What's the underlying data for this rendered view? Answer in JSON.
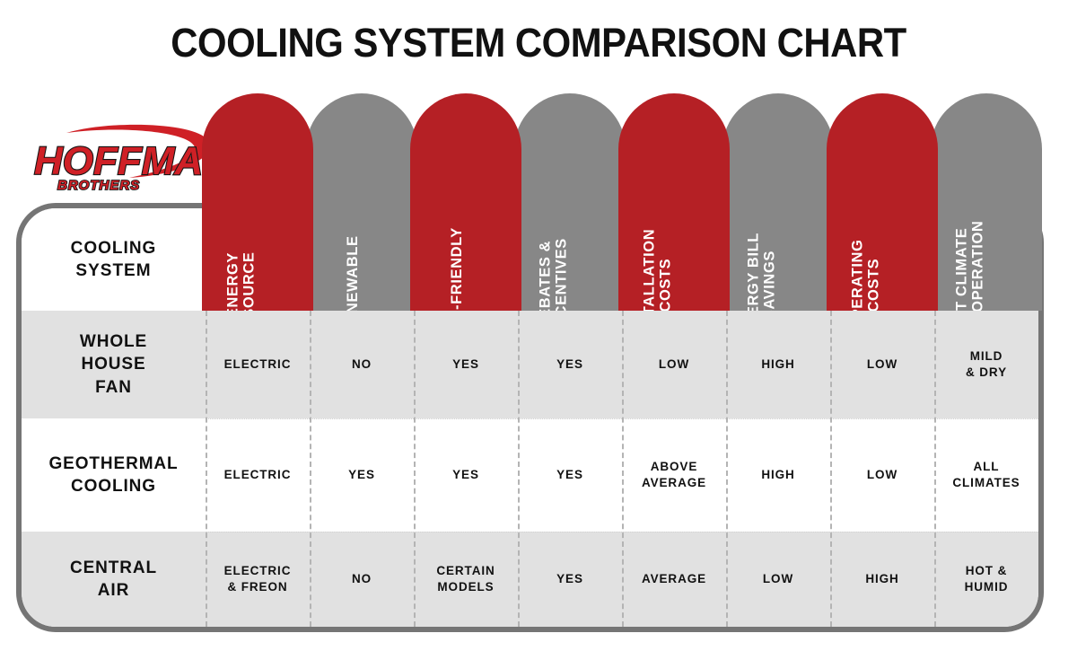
{
  "title": "COOLING SYSTEM COMPARISON CHART",
  "brand": {
    "logo_name": "hoffmann-brothers-logo",
    "word": "HOFFMANN",
    "sub": "BROTHERS",
    "red": "#cf2026",
    "outline": "#161616"
  },
  "colors": {
    "red_pill": "#b52025",
    "gray_pill": "#878787",
    "row_shaded": "#e1e1e1",
    "row_plain": "#ffffff",
    "card_border": "#757575",
    "divider": "#b4b4b4",
    "text": "#111111",
    "pill_text": "#ffffff"
  },
  "table": {
    "row_header_label": "COOLING SYSTEM",
    "row_header_lines": [
      "COOLING",
      "SYSTEM"
    ],
    "columns": [
      {
        "label": "ENERGY SOURCE",
        "lines": [
          "ENERGY",
          "SOURCE"
        ],
        "color": "red"
      },
      {
        "label": "RENEWABLE",
        "lines": [
          "RENEWABLE"
        ],
        "color": "gray"
      },
      {
        "label": "ECO-FRIENDLY",
        "lines": [
          "ECO-FRIENDLY"
        ],
        "color": "red"
      },
      {
        "label": "REBATES & INCENTIVES",
        "lines": [
          "REBATES &",
          "INCENTIVES"
        ],
        "color": "gray"
      },
      {
        "label": "INSTALLATION COSTS",
        "lines": [
          "INSTALLATION",
          "COSTS"
        ],
        "color": "red"
      },
      {
        "label": "ENERGY BILL SAVINGS",
        "lines": [
          "ENERGY BILL",
          "SAVINGS"
        ],
        "color": "gray"
      },
      {
        "label": "OPERATING COSTS",
        "lines": [
          "OPERATING",
          "COSTS"
        ],
        "color": "red"
      },
      {
        "label": "BEST CLIMATE FOR OPERATION",
        "lines": [
          "BEST CLIMATE",
          "FOR OPERATION"
        ],
        "color": "gray"
      }
    ],
    "rows": [
      {
        "system": "WHOLE HOUSE FAN",
        "system_lines": [
          "WHOLE",
          "HOUSE",
          "FAN"
        ],
        "band": "shaded",
        "cells": [
          {
            "value": "ELECTRIC",
            "lines": [
              "ELECTRIC"
            ]
          },
          {
            "value": "NO",
            "lines": [
              "NO"
            ]
          },
          {
            "value": "YES",
            "lines": [
              "YES"
            ]
          },
          {
            "value": "YES",
            "lines": [
              "YES"
            ]
          },
          {
            "value": "LOW",
            "lines": [
              "LOW"
            ]
          },
          {
            "value": "HIGH",
            "lines": [
              "HIGH"
            ]
          },
          {
            "value": "LOW",
            "lines": [
              "LOW"
            ]
          },
          {
            "value": "MILD & DRY",
            "lines": [
              "MILD",
              "& DRY"
            ]
          }
        ]
      },
      {
        "system": "GEOTHERMAL COOLING",
        "system_lines": [
          "GEOTHERMAL",
          "COOLING"
        ],
        "band": "plain",
        "cells": [
          {
            "value": "ELECTRIC",
            "lines": [
              "ELECTRIC"
            ]
          },
          {
            "value": "YES",
            "lines": [
              "YES"
            ]
          },
          {
            "value": "YES",
            "lines": [
              "YES"
            ]
          },
          {
            "value": "YES",
            "lines": [
              "YES"
            ]
          },
          {
            "value": "ABOVE AVERAGE",
            "lines": [
              "ABOVE",
              "AVERAGE"
            ]
          },
          {
            "value": "HIGH",
            "lines": [
              "HIGH"
            ]
          },
          {
            "value": "LOW",
            "lines": [
              "LOW"
            ]
          },
          {
            "value": "ALL CLIMATES",
            "lines": [
              "ALL",
              "CLIMATES"
            ]
          }
        ]
      },
      {
        "system": "CENTRAL AIR",
        "system_lines": [
          "CENTRAL",
          "AIR"
        ],
        "band": "shaded",
        "cells": [
          {
            "value": "ELECTRIC & FREON",
            "lines": [
              "ELECTRIC",
              "& FREON"
            ]
          },
          {
            "value": "NO",
            "lines": [
              "NO"
            ]
          },
          {
            "value": "CERTAIN MODELS",
            "lines": [
              "CERTAIN",
              "MODELS"
            ]
          },
          {
            "value": "YES",
            "lines": [
              "YES"
            ]
          },
          {
            "value": "AVERAGE",
            "lines": [
              "AVERAGE"
            ]
          },
          {
            "value": "LOW",
            "lines": [
              "LOW"
            ]
          },
          {
            "value": "HIGH",
            "lines": [
              "HIGH"
            ]
          },
          {
            "value": "HOT & HUMID",
            "lines": [
              "HOT &",
              "HUMID"
            ]
          }
        ]
      }
    ]
  },
  "chart_data": {
    "type": "table",
    "title": "COOLING SYSTEM COMPARISON CHART",
    "row_header": "COOLING SYSTEM",
    "columns": [
      "ENERGY SOURCE",
      "RENEWABLE",
      "ECO-FRIENDLY",
      "REBATES & INCENTIVES",
      "INSTALLATION COSTS",
      "ENERGY BILL SAVINGS",
      "OPERATING COSTS",
      "BEST CLIMATE FOR OPERATION"
    ],
    "rows": [
      {
        "name": "WHOLE HOUSE FAN",
        "values": [
          "ELECTRIC",
          "NO",
          "YES",
          "YES",
          "LOW",
          "HIGH",
          "LOW",
          "MILD & DRY"
        ]
      },
      {
        "name": "GEOTHERMAL COOLING",
        "values": [
          "ELECTRIC",
          "YES",
          "YES",
          "YES",
          "ABOVE AVERAGE",
          "HIGH",
          "LOW",
          "ALL CLIMATES"
        ]
      },
      {
        "name": "CENTRAL AIR",
        "values": [
          "ELECTRIC & FREON",
          "NO",
          "CERTAIN MODELS",
          "YES",
          "AVERAGE",
          "LOW",
          "HIGH",
          "HOT & HUMID"
        ]
      }
    ]
  }
}
